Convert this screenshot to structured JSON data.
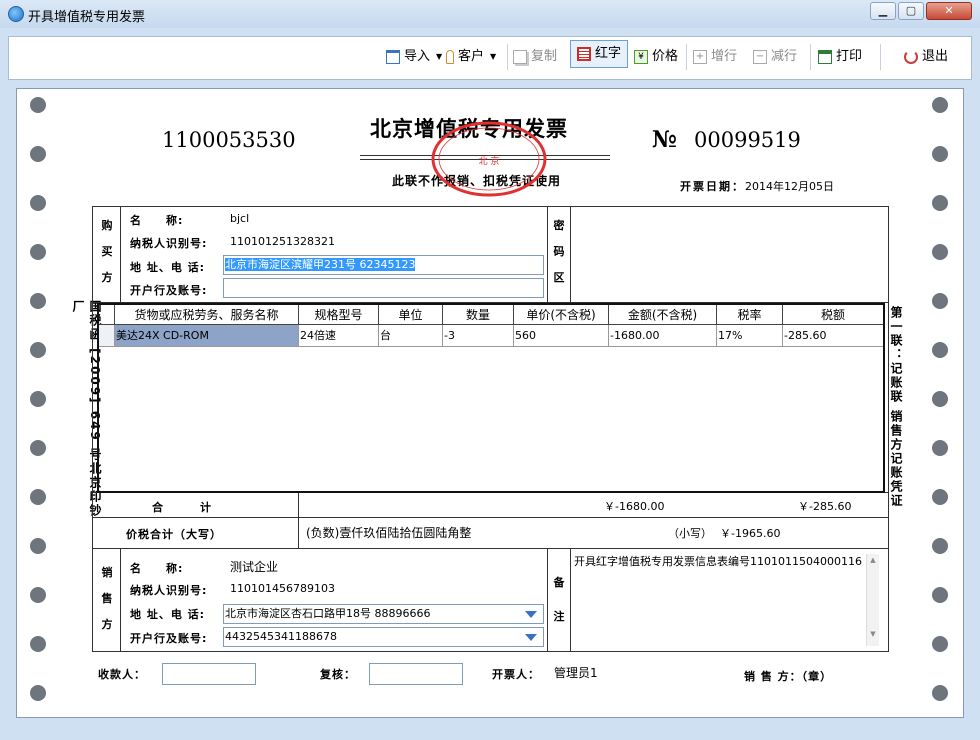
{
  "window": {
    "title": "开具增值税专用发票"
  },
  "toolbar": {
    "import": "导入",
    "customer": "客户",
    "copy": "复制",
    "red_letter": "红字",
    "price": "价格",
    "add_row": "增行",
    "delete_row": "减行",
    "print": "打印",
    "exit": "退出"
  },
  "invoice": {
    "code": "1100053530",
    "title": "北京增值税专用发票",
    "subtitle": "此联不作报销、扣税凭证使用",
    "no_sign": "№",
    "number": "00099519",
    "date_label": "开票日期：",
    "date": "2014年12月05日",
    "stamp_text": "中国税务·发票监制章 国家税务总局监制 北 京",
    "left_margin_text": "国税函 [2009] 649 号北京印钞厂",
    "right_margin_text": "第一联：记账联 销售方记账凭证"
  },
  "buyer": {
    "side_label": [
      "购",
      "买",
      "方"
    ],
    "name_label": "名　　称:",
    "name": "bjcl",
    "taxid_label": "纳税人识别号:",
    "taxid": "110101251328321",
    "address_label": "地 址、电 话:",
    "address": "北京市海淀区滨耀甲231号 62345123",
    "bank_label": "开户行及账号:",
    "bank": ""
  },
  "cipher": {
    "label": [
      "密",
      "码",
      "区"
    ]
  },
  "goods": {
    "headers": [
      "货物或应税劳务、服务名称",
      "规格型号",
      "单位",
      "数量",
      "单价(不含税)",
      "金额(不含税)",
      "税率",
      "税额"
    ],
    "rows": [
      [
        "美达24X CD-ROM",
        "24倍速",
        "台",
        "-3",
        "560",
        "-1680.00",
        "17%",
        "-285.60"
      ]
    ]
  },
  "totals": {
    "label": "合　　　计",
    "amount": "￥-1680.00",
    "tax": "￥-285.60",
    "grand_label": "价税合计（大写）",
    "grand_upper": "(负数)壹仟玖佰陆拾伍圆陆角整",
    "small_label": "（小写）",
    "grand_lower": "￥-1965.60"
  },
  "seller": {
    "side_label": [
      "销",
      "售",
      "方"
    ],
    "name_label": "名　　称:",
    "name": "测试企业",
    "taxid_label": "纳税人识别号:",
    "taxid": "110101456789103",
    "address_label": "地 址、电 话:",
    "address": "北京市海淀区杏石口路甲18号 88896666",
    "bank_label": "开户行及账号:",
    "bank": "4432545341188678"
  },
  "remarks": {
    "label": [
      "备",
      "注"
    ],
    "text": "开具红字增值税专用发票信息表编号1101011504000116"
  },
  "footer": {
    "payee_label": "收款人：",
    "reviewer_label": "复核：",
    "drawer_label": "开票人：",
    "drawer": "管理员1",
    "seller_stamp_label": "销 售 方：（章）"
  },
  "colors": {
    "selected_row": "#8ea3c8",
    "selection": "#3399ff",
    "stamp": "#e03030"
  }
}
